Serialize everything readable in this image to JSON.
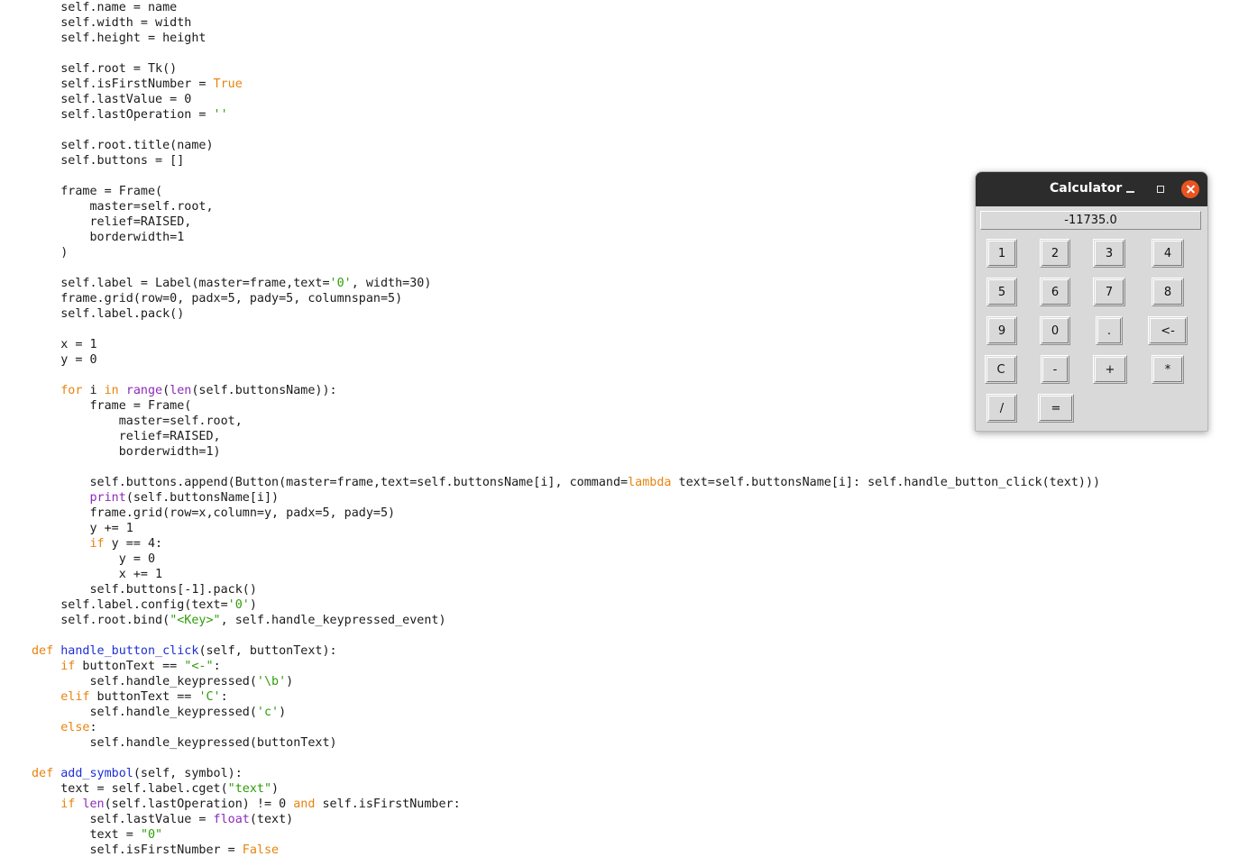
{
  "code_lines": [
    [
      {
        "t": "    self.name = name",
        "c": ""
      }
    ],
    [
      {
        "t": "    self.width = width",
        "c": ""
      }
    ],
    [
      {
        "t": "    self.height = height",
        "c": ""
      }
    ],
    [
      {
        "t": "",
        "c": ""
      }
    ],
    [
      {
        "t": "    self.root = Tk()",
        "c": ""
      }
    ],
    [
      {
        "t": "    self.isFirstNumber = ",
        "c": ""
      },
      {
        "t": "True",
        "c": "kw"
      }
    ],
    [
      {
        "t": "    self.lastValue = 0",
        "c": ""
      }
    ],
    [
      {
        "t": "    self.lastOperation = ",
        "c": ""
      },
      {
        "t": "''",
        "c": "str"
      }
    ],
    [
      {
        "t": "",
        "c": ""
      }
    ],
    [
      {
        "t": "    self.root.title(name)",
        "c": ""
      }
    ],
    [
      {
        "t": "    self.buttons = []",
        "c": ""
      }
    ],
    [
      {
        "t": "",
        "c": ""
      }
    ],
    [
      {
        "t": "    frame = Frame(",
        "c": ""
      }
    ],
    [
      {
        "t": "        master=self.root,",
        "c": ""
      }
    ],
    [
      {
        "t": "        relief=RAISED,",
        "c": ""
      }
    ],
    [
      {
        "t": "        borderwidth=1",
        "c": ""
      }
    ],
    [
      {
        "t": "    )",
        "c": ""
      }
    ],
    [
      {
        "t": "",
        "c": ""
      }
    ],
    [
      {
        "t": "    self.label = Label(master=frame,text=",
        "c": ""
      },
      {
        "t": "'0'",
        "c": "str"
      },
      {
        "t": ", width=30)",
        "c": ""
      }
    ],
    [
      {
        "t": "    frame.grid(row=0, padx=5, pady=5, columnspan=5)",
        "c": ""
      }
    ],
    [
      {
        "t": "    self.label.pack()",
        "c": ""
      }
    ],
    [
      {
        "t": "",
        "c": ""
      }
    ],
    [
      {
        "t": "    x = 1",
        "c": ""
      }
    ],
    [
      {
        "t": "    y = 0",
        "c": ""
      }
    ],
    [
      {
        "t": "",
        "c": ""
      }
    ],
    [
      {
        "t": "    ",
        "c": ""
      },
      {
        "t": "for",
        "c": "kw"
      },
      {
        "t": " i ",
        "c": ""
      },
      {
        "t": "in",
        "c": "kw"
      },
      {
        "t": " ",
        "c": ""
      },
      {
        "t": "range",
        "c": "bi"
      },
      {
        "t": "(",
        "c": ""
      },
      {
        "t": "len",
        "c": "bi"
      },
      {
        "t": "(self.buttonsName)):",
        "c": ""
      }
    ],
    [
      {
        "t": "        frame = Frame(",
        "c": ""
      }
    ],
    [
      {
        "t": "            master=self.root,",
        "c": ""
      }
    ],
    [
      {
        "t": "            relief=RAISED,",
        "c": ""
      }
    ],
    [
      {
        "t": "            borderwidth=1)",
        "c": ""
      }
    ],
    [
      {
        "t": "",
        "c": ""
      }
    ],
    [
      {
        "t": "        self.buttons.append(Button(master=frame,text=self.buttonsName[i], command=",
        "c": ""
      },
      {
        "t": "lambda",
        "c": "kw"
      },
      {
        "t": " text=self.buttonsName[i]: self.handle_button_click(text)))",
        "c": ""
      }
    ],
    [
      {
        "t": "        ",
        "c": ""
      },
      {
        "t": "print",
        "c": "bi"
      },
      {
        "t": "(self.buttonsName[i])",
        "c": ""
      }
    ],
    [
      {
        "t": "        frame.grid(row=x,column=y, padx=5, pady=5)",
        "c": ""
      }
    ],
    [
      {
        "t": "        y += 1",
        "c": ""
      }
    ],
    [
      {
        "t": "        ",
        "c": ""
      },
      {
        "t": "if",
        "c": "kw"
      },
      {
        "t": " y == 4:",
        "c": ""
      }
    ],
    [
      {
        "t": "            y = 0",
        "c": ""
      }
    ],
    [
      {
        "t": "            x += 1",
        "c": ""
      }
    ],
    [
      {
        "t": "        self.buttons[-1].pack()",
        "c": ""
      }
    ],
    [
      {
        "t": "    self.label.config(text=",
        "c": ""
      },
      {
        "t": "'0'",
        "c": "str"
      },
      {
        "t": ")",
        "c": ""
      }
    ],
    [
      {
        "t": "    self.root.bind(",
        "c": ""
      },
      {
        "t": "\"<Key>\"",
        "c": "str"
      },
      {
        "t": ", self.handle_keypressed_event)",
        "c": ""
      }
    ],
    [
      {
        "t": "",
        "c": ""
      }
    ],
    [
      {
        "t": "def",
        "c": "kw"
      },
      {
        "t": " ",
        "c": ""
      },
      {
        "t": "handle_button_click",
        "c": "fn"
      },
      {
        "t": "(self, buttonText):",
        "c": ""
      }
    ],
    [
      {
        "t": "    ",
        "c": ""
      },
      {
        "t": "if",
        "c": "kw"
      },
      {
        "t": " buttonText == ",
        "c": ""
      },
      {
        "t": "\"<-\"",
        "c": "str"
      },
      {
        "t": ":",
        "c": ""
      }
    ],
    [
      {
        "t": "        self.handle_keypressed(",
        "c": ""
      },
      {
        "t": "'\\b'",
        "c": "str"
      },
      {
        "t": ")",
        "c": ""
      }
    ],
    [
      {
        "t": "    ",
        "c": ""
      },
      {
        "t": "elif",
        "c": "kw"
      },
      {
        "t": " buttonText == ",
        "c": ""
      },
      {
        "t": "'C'",
        "c": "str"
      },
      {
        "t": ":",
        "c": ""
      }
    ],
    [
      {
        "t": "        self.handle_keypressed(",
        "c": ""
      },
      {
        "t": "'c'",
        "c": "str"
      },
      {
        "t": ")",
        "c": ""
      }
    ],
    [
      {
        "t": "    ",
        "c": ""
      },
      {
        "t": "else",
        "c": "kw"
      },
      {
        "t": ":",
        "c": ""
      }
    ],
    [
      {
        "t": "        self.handle_keypressed(buttonText)",
        "c": ""
      }
    ],
    [
      {
        "t": "",
        "c": ""
      }
    ],
    [
      {
        "t": "def",
        "c": "kw"
      },
      {
        "t": " ",
        "c": ""
      },
      {
        "t": "add_symbol",
        "c": "fn"
      },
      {
        "t": "(self, symbol):",
        "c": ""
      }
    ],
    [
      {
        "t": "    text = self.label.cget(",
        "c": ""
      },
      {
        "t": "\"text\"",
        "c": "str"
      },
      {
        "t": ")",
        "c": ""
      }
    ],
    [
      {
        "t": "    ",
        "c": ""
      },
      {
        "t": "if",
        "c": "kw"
      },
      {
        "t": " ",
        "c": ""
      },
      {
        "t": "len",
        "c": "bi"
      },
      {
        "t": "(self.lastOperation) != 0 ",
        "c": ""
      },
      {
        "t": "and",
        "c": "kw"
      },
      {
        "t": " self.isFirstNumber:",
        "c": ""
      }
    ],
    [
      {
        "t": "        self.lastValue = ",
        "c": ""
      },
      {
        "t": "float",
        "c": "bi"
      },
      {
        "t": "(text)",
        "c": ""
      }
    ],
    [
      {
        "t": "        text = ",
        "c": ""
      },
      {
        "t": "\"0\"",
        "c": "str"
      }
    ],
    [
      {
        "t": "        self.isFirstNumber = ",
        "c": ""
      },
      {
        "t": "False",
        "c": "kw"
      }
    ]
  ],
  "calculator": {
    "title": "Calculator",
    "display": "-11735.0",
    "controls": {
      "minimize": "minimize-icon",
      "maximize": "maximize-icon",
      "close": "close-icon"
    },
    "keys": [
      "1",
      "2",
      "3",
      "4",
      "5",
      "6",
      "7",
      "8",
      "9",
      "0",
      ".",
      "<-",
      "C",
      "-",
      "+",
      "*",
      "/",
      "="
    ]
  },
  "colors": {
    "keyword": "#e8830c",
    "string": "#2f9c0a",
    "builtin": "#8d2bb8",
    "function": "#1f2fd6",
    "titlebar": "#2c2c2c",
    "close": "#e95420",
    "window_bg": "#d9d9d9"
  }
}
